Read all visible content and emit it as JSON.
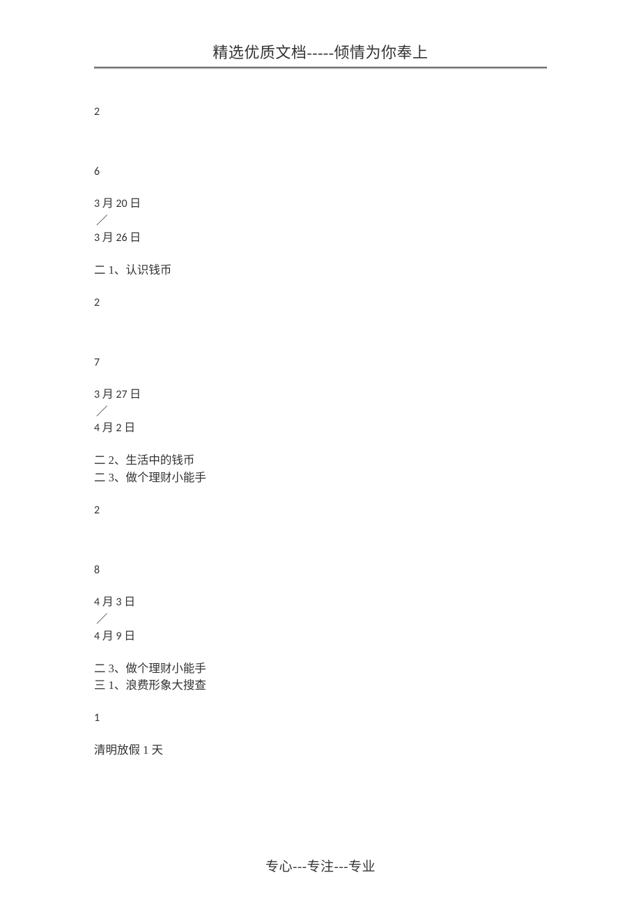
{
  "header": {
    "title": "精选优质文档-----倾情为你奉上"
  },
  "content": {
    "l1": "2",
    "l2": "6",
    "w6_date_start": "3 月 20 日",
    "slash1": "／",
    "w6_date_end": "3 月 26 日",
    "w6_topic1": "二 1、认识钱币",
    "l3": "2",
    "l4": "7",
    "w7_date_start": "3 月 27 日",
    "slash2": "／",
    "w7_date_end": "4 月 2 日",
    "w7_topic1": "二 2、生活中的钱币",
    "w7_topic2": "二 3、做个理财小能手",
    "l5": "2",
    "l6": "8",
    "w8_date_start": "4 月 3 日",
    "slash3": "／",
    "w8_date_end": "4 月 9 日",
    "w8_topic1": "二 3、做个理财小能手",
    "w8_topic2": "三 1、浪费形象大搜查",
    "l7": "1",
    "w8_note": "清明放假 1 天"
  },
  "footer": {
    "text": "专心---专注---专业"
  }
}
